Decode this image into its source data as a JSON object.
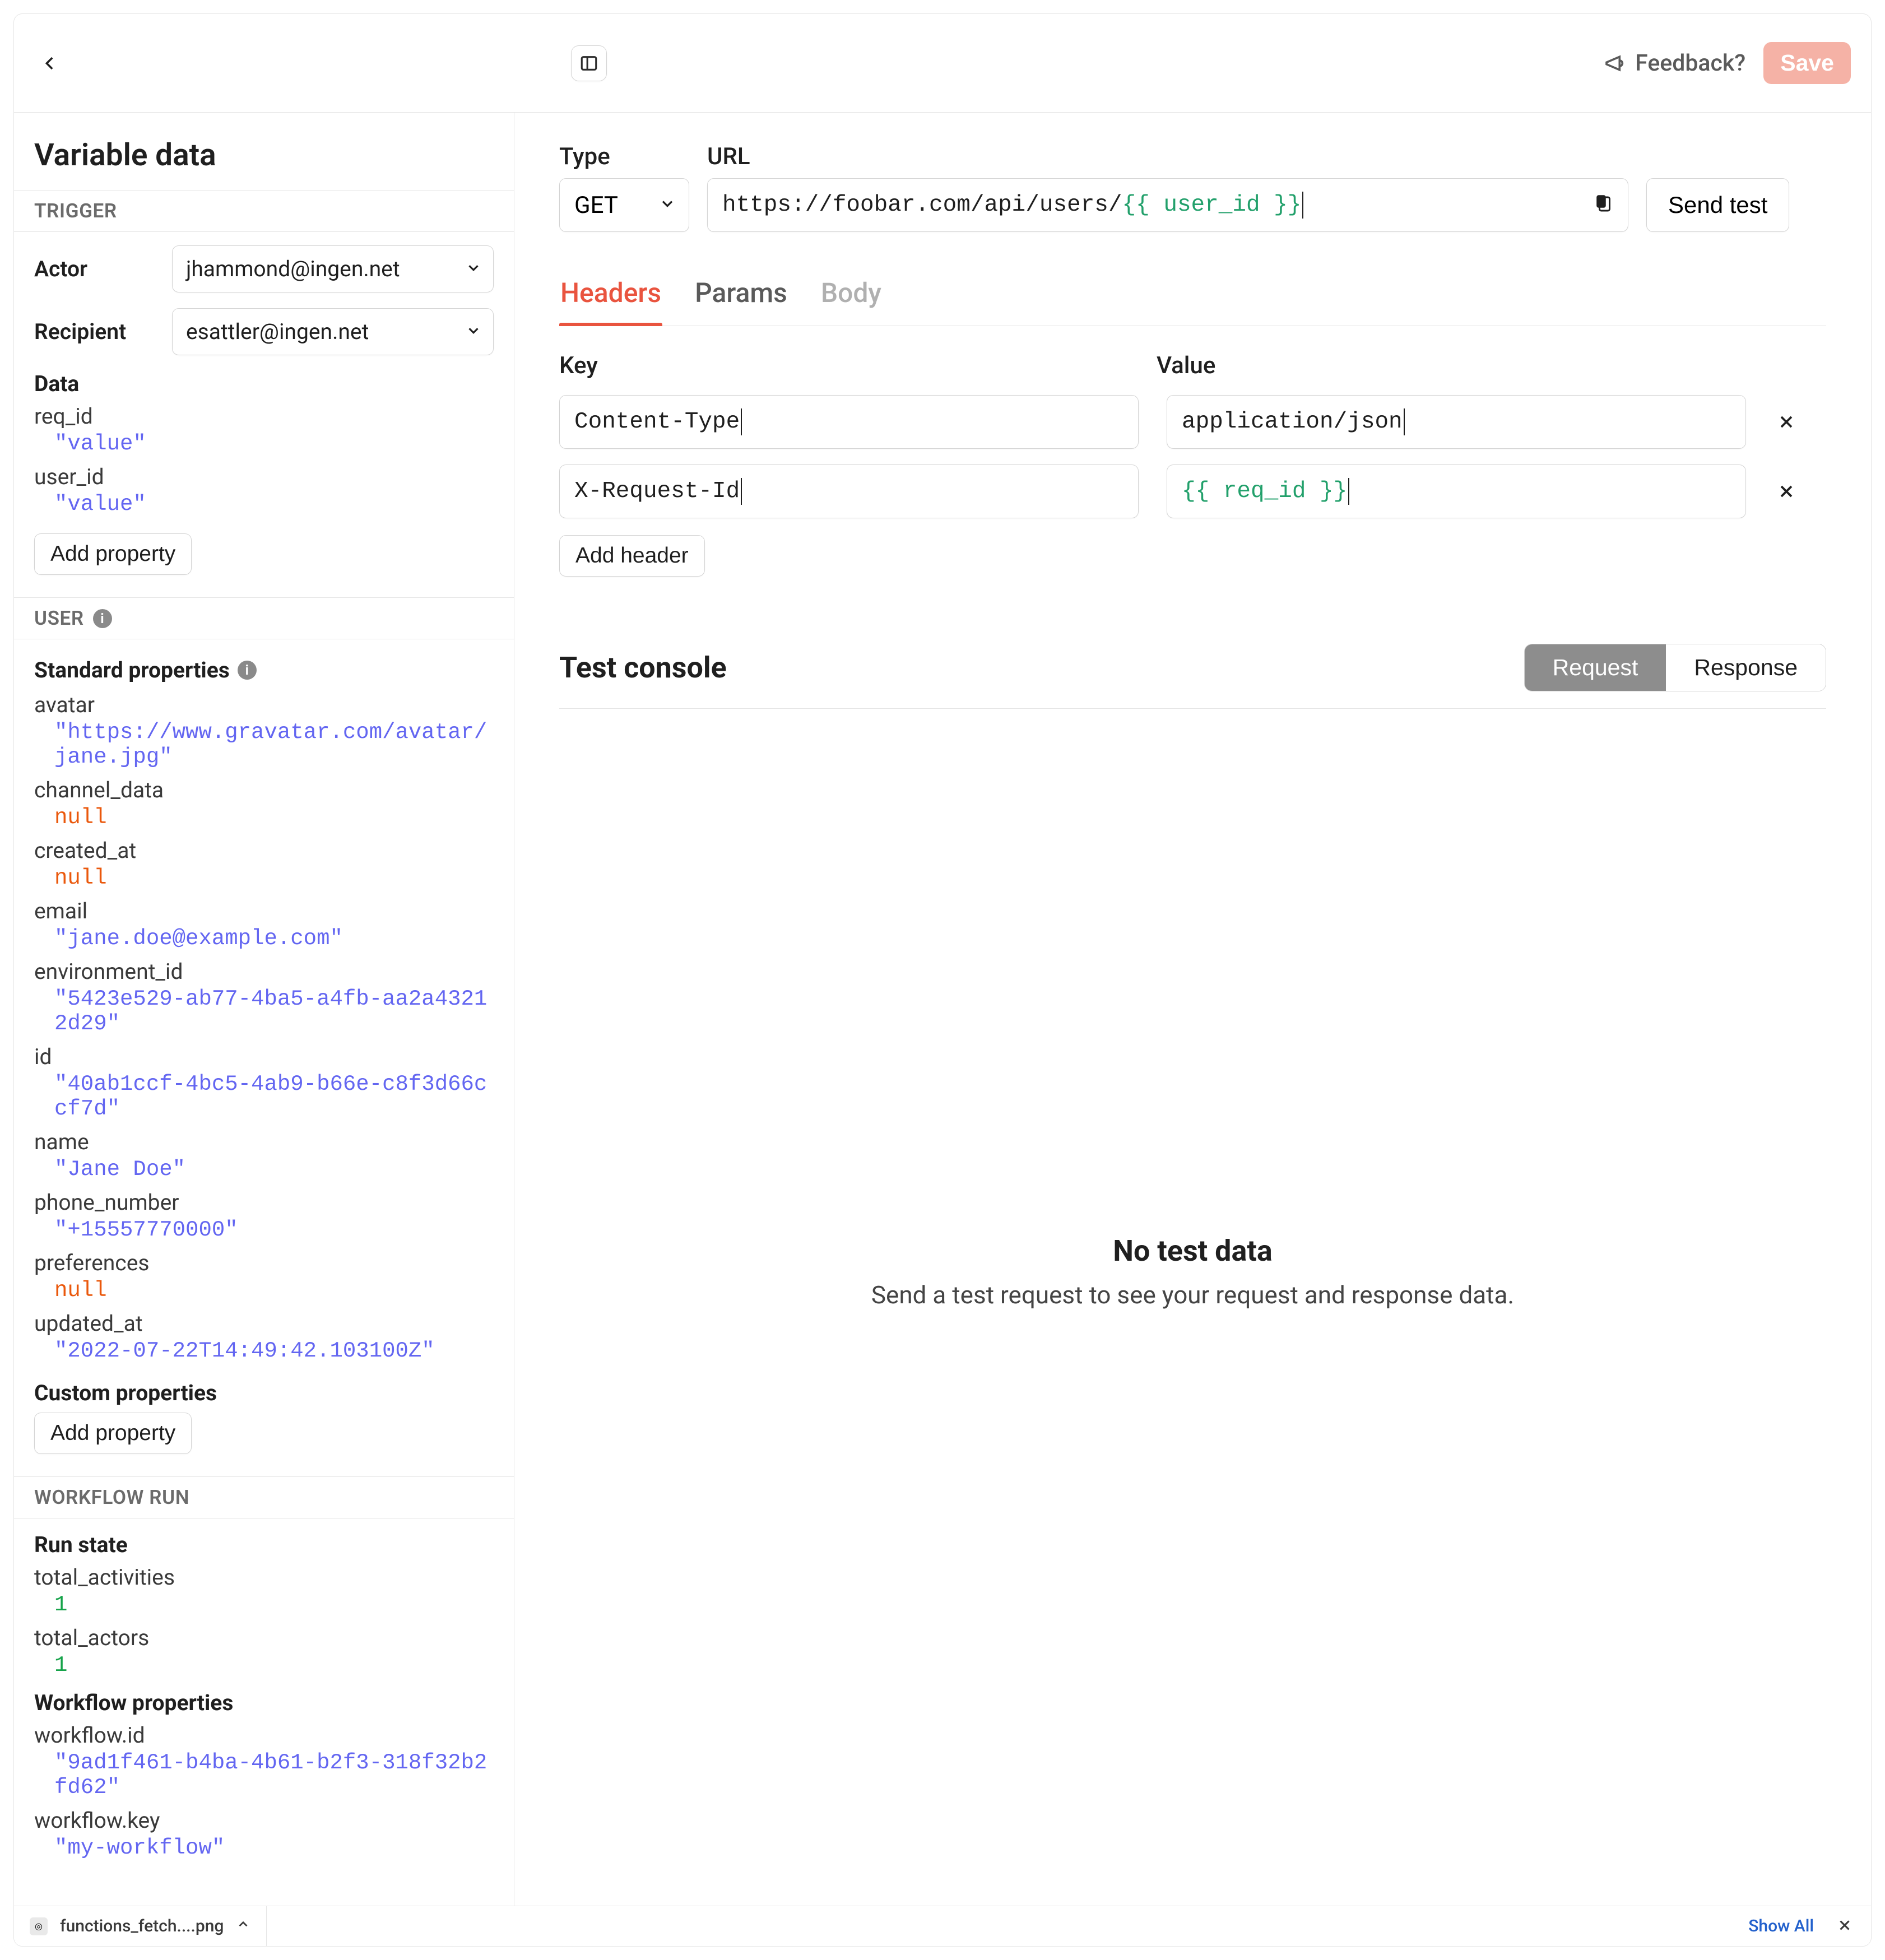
{
  "topbar": {
    "feedback_label": "Feedback?",
    "save_label": "Save"
  },
  "sidebar": {
    "title": "Variable data",
    "trigger": {
      "section_label": "TRIGGER",
      "actor_label": "Actor",
      "actor_value": "jhammond@ingen.net",
      "recipient_label": "Recipient",
      "recipient_value": "esattler@ingen.net",
      "data_label": "Data",
      "data_items": [
        {
          "key": "req_id",
          "value": "\"value\"",
          "type": "string"
        },
        {
          "key": "user_id",
          "value": "\"value\"",
          "type": "string"
        }
      ],
      "add_property_label": "Add property"
    },
    "user": {
      "section_label": "USER",
      "standard_props_label": "Standard properties",
      "standard_items": [
        {
          "key": "avatar",
          "value": "\"https://www.gravatar.com/avatar/jane.jpg\"",
          "type": "string"
        },
        {
          "key": "channel_data",
          "value": "null",
          "type": "null"
        },
        {
          "key": "created_at",
          "value": "null",
          "type": "null"
        },
        {
          "key": "email",
          "value": "\"jane.doe@example.com\"",
          "type": "string"
        },
        {
          "key": "environment_id",
          "value": "\"5423e529-ab77-4ba5-a4fb-aa2a43212d29\"",
          "type": "string"
        },
        {
          "key": "id",
          "value": "\"40ab1ccf-4bc5-4ab9-b66e-c8f3d66ccf7d\"",
          "type": "string"
        },
        {
          "key": "name",
          "value": "\"Jane Doe\"",
          "type": "string"
        },
        {
          "key": "phone_number",
          "value": "\"+15557770000\"",
          "type": "string"
        },
        {
          "key": "preferences",
          "value": "null",
          "type": "null"
        },
        {
          "key": "updated_at",
          "value": "\"2022-07-22T14:49:42.103100Z\"",
          "type": "string"
        }
      ],
      "custom_props_label": "Custom properties",
      "add_property_label": "Add property"
    },
    "workflow_run": {
      "section_label": "WORKFLOW RUN",
      "run_state_label": "Run state",
      "run_state_items": [
        {
          "key": "total_activities",
          "value": "1",
          "type": "num"
        },
        {
          "key": "total_actors",
          "value": "1",
          "type": "num"
        }
      ],
      "workflow_props_label": "Workflow properties",
      "workflow_items": [
        {
          "key": "workflow.id",
          "value": "\"9ad1f461-b4ba-4b61-b2f3-318f32b2fd62\"",
          "type": "string"
        },
        {
          "key": "workflow.key",
          "value": "\"my-workflow\"",
          "type": "string"
        }
      ]
    }
  },
  "request": {
    "type_label": "Type",
    "type_value": "GET",
    "url_label": "URL",
    "url_prefix": "https://foobar.com/api/users/",
    "url_template": "{{ user_id }}",
    "send_label": "Send test"
  },
  "tabs": {
    "headers": "Headers",
    "params": "Params",
    "body": "Body"
  },
  "headers_editor": {
    "key_label": "Key",
    "value_label": "Value",
    "rows": [
      {
        "key": "Content-Type",
        "value": "application/json",
        "value_is_template": false
      },
      {
        "key": "X-Request-Id",
        "value": "{{ req_id }}",
        "value_is_template": true
      }
    ],
    "add_label": "Add header"
  },
  "console": {
    "title": "Test console",
    "request_tab": "Request",
    "response_tab": "Response",
    "empty_title": "No test data",
    "empty_body": "Send a test request to see your request and response data."
  },
  "bottombar": {
    "file_name": "functions_fetch....png",
    "show_all": "Show All"
  }
}
